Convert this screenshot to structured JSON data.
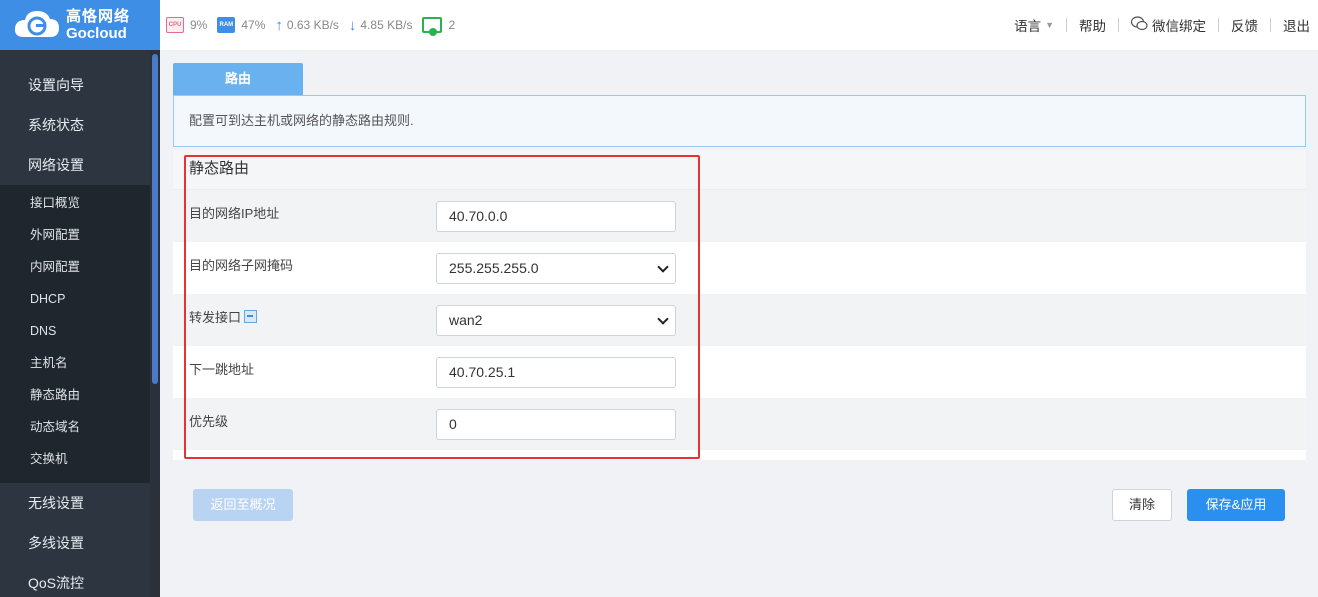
{
  "brand": {
    "name_cn": "高恪网络",
    "name_en": "Gocloud",
    "accent": "#3f8ee6"
  },
  "stats": {
    "cpu_chip": "CPU",
    "cpu": "9%",
    "ram_chip": "RAM",
    "ram": "47%",
    "upload": "0.63 KB/s",
    "download": "4.85 KB/s",
    "devices": "2"
  },
  "topnav": {
    "language": "语言",
    "help": "帮助",
    "wechat": "微信绑定",
    "feedback": "反馈",
    "logout": "退出"
  },
  "sidebar": {
    "items": [
      "设置向导",
      "系统状态",
      "网络设置"
    ],
    "sub_items": [
      "接口概览",
      "外网配置",
      "内网配置",
      "DHCP",
      "DNS",
      "主机名",
      "静态路由",
      "动态域名",
      "交换机"
    ],
    "items_after": [
      "无线设置",
      "多线设置",
      "QoS流控"
    ]
  },
  "tab": {
    "label": "路由"
  },
  "description": "配置可到达主机或网络的静态路由规则.",
  "panel": {
    "title": "静态路由",
    "fields": {
      "dest_ip": {
        "label": "目的网络IP地址",
        "value": "40.70.0.0"
      },
      "mask": {
        "label": "目的网络子网掩码",
        "value": "255.255.255.0"
      },
      "iface": {
        "label": "转发接口",
        "value": "wan2"
      },
      "gateway": {
        "label": "下一跳地址",
        "value": "40.70.25.1"
      },
      "priority": {
        "label": "优先级",
        "value": "0"
      }
    }
  },
  "buttons": {
    "back": "返回至概况",
    "clear": "清除",
    "save": "保存&应用"
  },
  "colors": {
    "highlight": "#e53333",
    "primary_button": "#2b8ff0",
    "tab": "#6ab2ef"
  }
}
